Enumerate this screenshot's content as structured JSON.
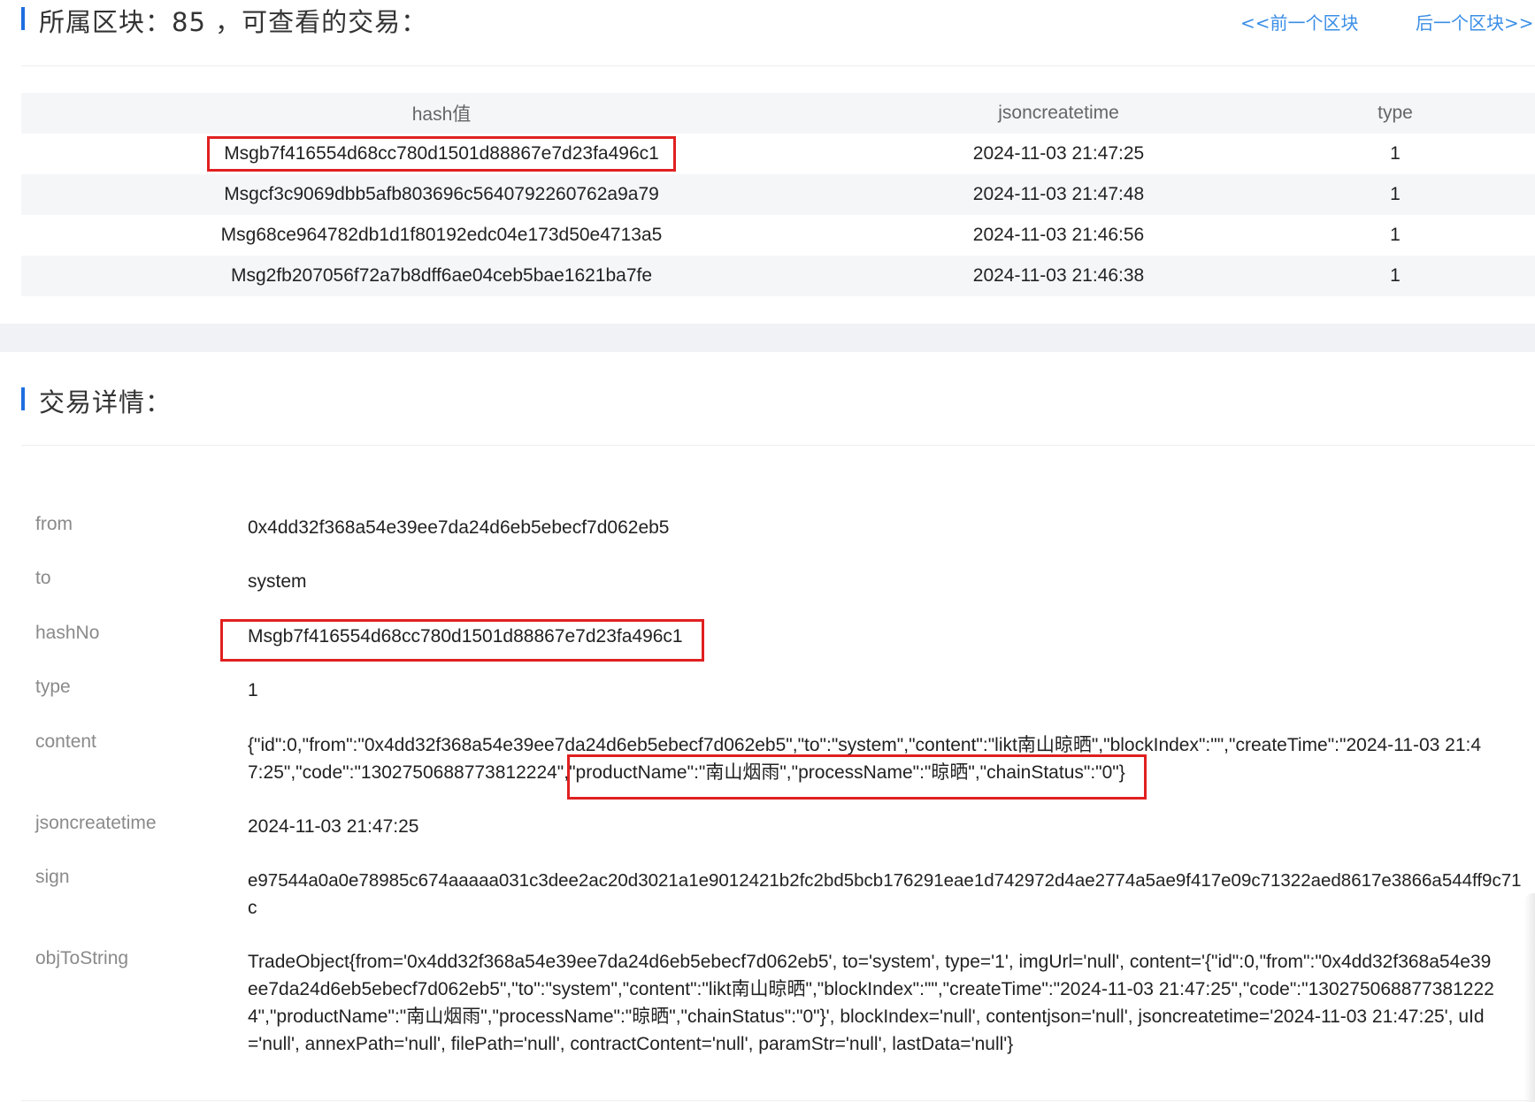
{
  "block": {
    "title": "所属区块：85 ，可查看的交易：",
    "prev_link": "<<前一个区块",
    "next_link": "后一个区块>>",
    "table": {
      "headers": [
        "hash值",
        "jsoncreatetime",
        "type"
      ],
      "rows": [
        {
          "hash": "Msgb7f416554d68cc780d1501d88867e7d23fa496c1",
          "time": "2024-11-03 21:47:25",
          "type": "1"
        },
        {
          "hash": "Msgcf3c9069dbb5afb803696c5640792260762a9a79",
          "time": "2024-11-03 21:47:48",
          "type": "1"
        },
        {
          "hash": "Msg68ce964782db1d1f80192edc04e173d50e4713a5",
          "time": "2024-11-03 21:46:56",
          "type": "1"
        },
        {
          "hash": "Msg2fb207056f72a7b8dff6ae04ceb5bae1621ba7fe",
          "time": "2024-11-03 21:46:38",
          "type": "1"
        }
      ]
    }
  },
  "detail": {
    "title": "交易详情：",
    "fields": {
      "from": {
        "label": "from",
        "value": "0x4dd32f368a54e39ee7da24d6eb5ebecf7d062eb5"
      },
      "to": {
        "label": "to",
        "value": "system"
      },
      "hashNo": {
        "label": "hashNo",
        "value": "Msgb7f416554d68cc780d1501d88867e7d23fa496c1"
      },
      "type": {
        "label": "type",
        "value": "1"
      },
      "content": {
        "label": "content",
        "line1": "{\"id\":0,\"from\":\"0x4dd32f368a54e39ee7da24d6eb5ebecf7d062eb5\",\"to\":\"system\",\"content\":\"likt南山晾晒\",\"blockIndex\":\"\",\"createTime\":\"2024-11-03 21:4",
        "line2_a": "7:25\",\"code\":\"1302750688773812224\",",
        "line2_b": "\"productName\":\"南山烟雨\",\"processName\":\"晾晒\",\"chainStatus\":\"0\"}"
      },
      "jsoncreatetime": {
        "label": "jsoncreatetime",
        "value": "2024-11-03 21:47:25"
      },
      "sign": {
        "label": "sign",
        "line1": "e97544a0a0e78985c674aaaaa031c3dee2ac20d3021a1e9012421b2fc2bd5bcb176291eae1d742972d4ae2774a5ae9f417e09c71322aed8617e3866a544ff9c71",
        "line2": "c"
      },
      "objToString": {
        "label": "objToString",
        "line1": "TradeObject{from='0x4dd32f368a54e39ee7da24d6eb5ebecf7d062eb5', to='system', type='1', imgUrl='null', content='{\"id\":0,\"from\":\"0x4dd32f368a54e39",
        "line2": "ee7da24d6eb5ebecf7d062eb5\",\"to\":\"system\",\"content\":\"likt南山晾晒\",\"blockIndex\":\"\",\"createTime\":\"2024-11-03 21:47:25\",\"code\":\"130275068877381222",
        "line3": "4\",\"productName\":\"南山烟雨\",\"processName\":\"晾晒\",\"chainStatus\":\"0\"}', blockIndex='null', contentjson='null', jsoncreatetime='2024-11-03 21:47:25', uId",
        "line4": "='null', annexPath='null', filePath='null', contractContent='null', paramStr='null', lastData='null'}"
      }
    }
  },
  "colors": {
    "accent": "#1e6fe0",
    "link": "#3a8ee6",
    "highlight": "#e02020",
    "row_stripe": "#f5f6f8"
  }
}
